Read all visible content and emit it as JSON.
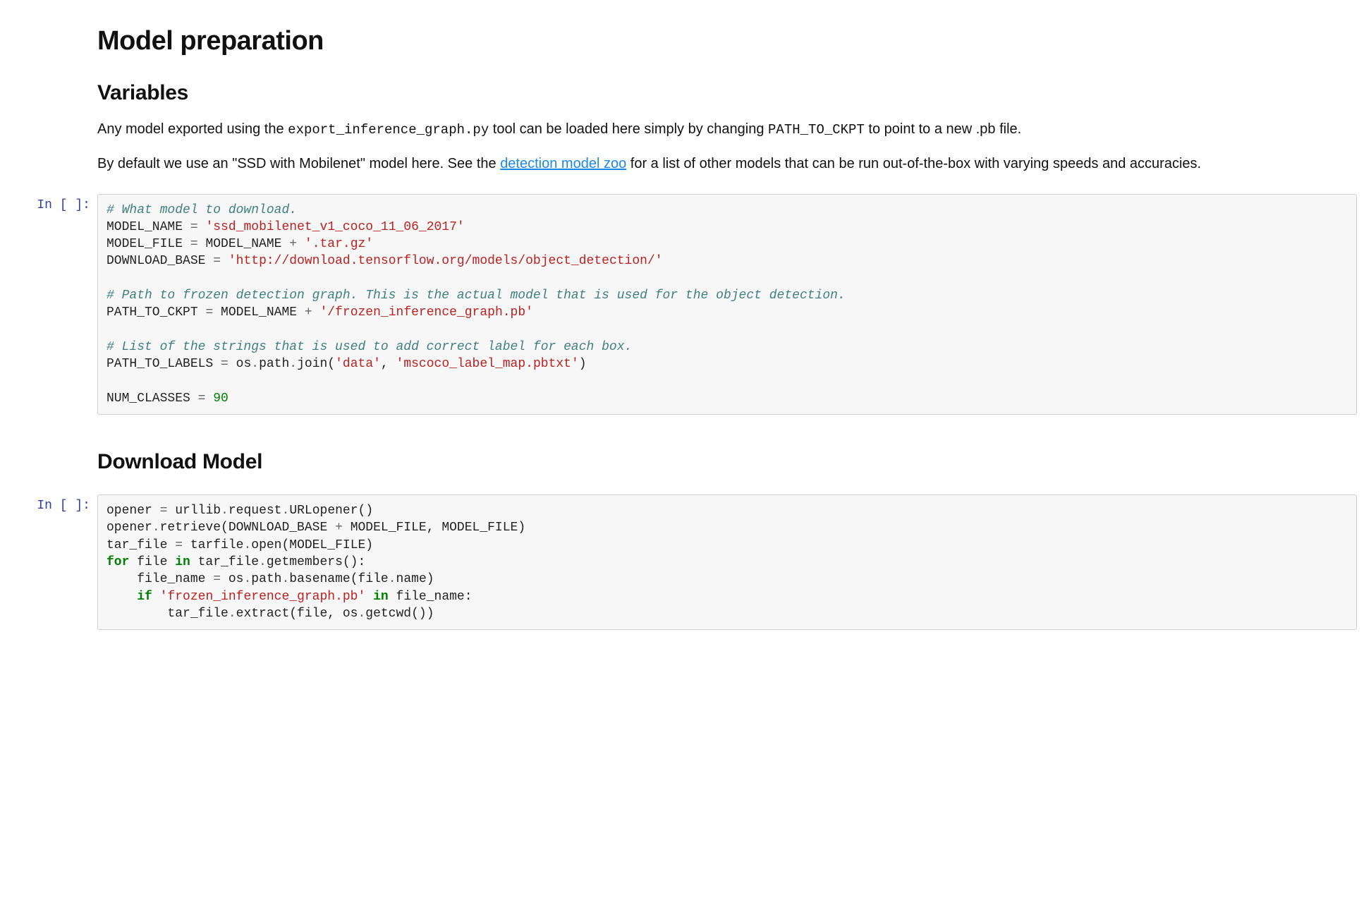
{
  "headings": {
    "h1": "Model preparation",
    "h2_vars": "Variables",
    "h2_download": "Download Model"
  },
  "prose": {
    "p1a": "Any model exported using the ",
    "p1_code1": "export_inference_graph.py",
    "p1b": " tool can be loaded here simply by changing ",
    "p1_code2": "PATH_TO_CKPT",
    "p1c": " to point to a new .pb file.",
    "p2a": "By default we use an \"SSD with Mobilenet\" model here. See the ",
    "p2_link": "detection model zoo",
    "p2b": " for a list of other models that can be run out-of-the-box with varying speeds and accuracies."
  },
  "prompts": {
    "cell1": "In [ ]:",
    "cell2": "In [ ]:"
  },
  "code1": {
    "c1": "# What model to download.",
    "l2a": "MODEL_NAME ",
    "l2b": "=",
    "l2c": " ",
    "l2d": "'ssd_mobilenet_v1_coco_11_06_2017'",
    "l3a": "MODEL_FILE ",
    "l3b": "=",
    "l3c": " MODEL_NAME ",
    "l3d": "+",
    "l3e": " ",
    "l3f": "'.tar.gz'",
    "l4a": "DOWNLOAD_BASE ",
    "l4b": "=",
    "l4c": " ",
    "l4d": "'http://download.tensorflow.org/models/object_detection/'",
    "c2": "# Path to frozen detection graph. This is the actual model that is used for the object detection.",
    "l6a": "PATH_TO_CKPT ",
    "l6b": "=",
    "l6c": " MODEL_NAME ",
    "l6d": "+",
    "l6e": " ",
    "l6f": "'/frozen_inference_graph.pb'",
    "c3": "# List of the strings that is used to add correct label for each box.",
    "l8a": "PATH_TO_LABELS ",
    "l8b": "=",
    "l8c": " os",
    "l8d": ".",
    "l8e": "path",
    "l8f": ".",
    "l8g": "join(",
    "l8h": "'data'",
    "l8i": ", ",
    "l8j": "'mscoco_label_map.pbtxt'",
    "l8k": ")",
    "l9a": "NUM_CLASSES ",
    "l9b": "=",
    "l9c": " ",
    "l9d": "90"
  },
  "code2": {
    "l1a": "opener ",
    "l1b": "=",
    "l1c": " urllib",
    "l1d": ".",
    "l1e": "request",
    "l1f": ".",
    "l1g": "URLopener()",
    "l2a": "opener",
    "l2b": ".",
    "l2c": "retrieve(DOWNLOAD_BASE ",
    "l2d": "+",
    "l2e": " MODEL_FILE, MODEL_FILE)",
    "l3a": "tar_file ",
    "l3b": "=",
    "l3c": " tarfile",
    "l3d": ".",
    "l3e": "open(MODEL_FILE)",
    "l4a": "for",
    "l4b": " file ",
    "l4c": "in",
    "l4d": " tar_file",
    "l4e": ".",
    "l4f": "getmembers():",
    "l5a": "    file_name ",
    "l5b": "=",
    "l5c": " os",
    "l5d": ".",
    "l5e": "path",
    "l5f": ".",
    "l5g": "basename(file",
    "l5h": ".",
    "l5i": "name)",
    "l6a": "    ",
    "l6b": "if",
    "l6c": " ",
    "l6d": "'frozen_inference_graph.pb'",
    "l6e": " ",
    "l6f": "in",
    "l6g": " file_name:",
    "l7a": "        tar_file",
    "l7b": ".",
    "l7c": "extract(file, os",
    "l7d": ".",
    "l7e": "getcwd())"
  }
}
